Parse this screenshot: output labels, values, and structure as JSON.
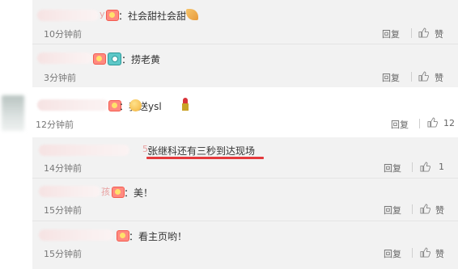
{
  "comments": [
    {
      "name_tail": "y",
      "text": "：社会甜社会甜",
      "time": "10分钟前",
      "reply_label": "回复",
      "like_label": "赞"
    },
    {
      "name_tail": "",
      "text": "：捞老黄",
      "time": "3分钟前",
      "reply_label": "回复",
      "like_label": "赞"
    },
    {
      "name_tail": "",
      "text": "：我送ysl",
      "time": "12分钟前",
      "reply_label": "回复",
      "like_count": "12"
    },
    {
      "name_tail": "5",
      "text": "张继科还有三秒到达现场",
      "text_prefix": "：",
      "time": "14分钟前",
      "reply_label": "回复",
      "like_count": "1"
    },
    {
      "name_tail": "孩",
      "text": "：美！",
      "time": "15分钟前",
      "reply_label": "回复",
      "like_label": "赞"
    },
    {
      "name_tail": "",
      "text": "：看主页哟！",
      "time": "15分钟前",
      "reply_label": "回复",
      "like_label": "赞"
    }
  ],
  "colors": {
    "underline": "#e4393c",
    "reply_bg": "#f2f2f2"
  }
}
